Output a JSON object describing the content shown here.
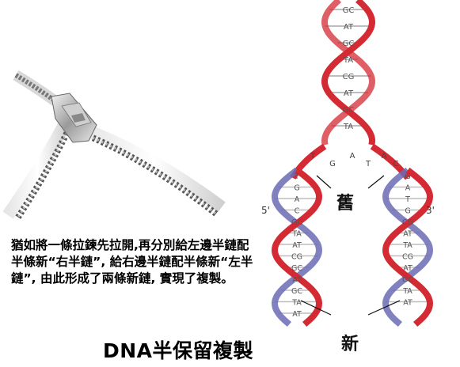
{
  "description": "猶如將一條拉鍊先拉開,再分別給左邊半鏈配半條新“右半鏈”, 給右邊半鏈配半條新“左半鏈”, 由此形成了兩條新鏈, 實現了複製。",
  "title": "DNA半保留複製",
  "diagram": {
    "old_label": "舊",
    "new_label": "新",
    "end_label_left": "5'",
    "end_label_right": "3'",
    "pairs_top": [
      "GC",
      "AT",
      "GC",
      "TA",
      "CG",
      "AT",
      "GC",
      "TA"
    ],
    "fork_bases": [
      "T",
      "G",
      "A",
      "T",
      "A",
      "C"
    ],
    "left_bases": [
      "T",
      "G",
      "A",
      "C",
      "GC",
      "TA",
      "AT",
      "CG",
      "GC",
      "AT",
      "GC",
      "TA",
      "AT"
    ],
    "right_bases": [
      "G",
      "A",
      "T",
      "G",
      "CG",
      "AT",
      "TA",
      "CG",
      "AT",
      "GC",
      "TA",
      "AT"
    ],
    "colors": {
      "old_strand": "#d42a34",
      "new_strand": "#6b6bb5",
      "rung": "#bdbdbd",
      "label": "#111111"
    }
  }
}
